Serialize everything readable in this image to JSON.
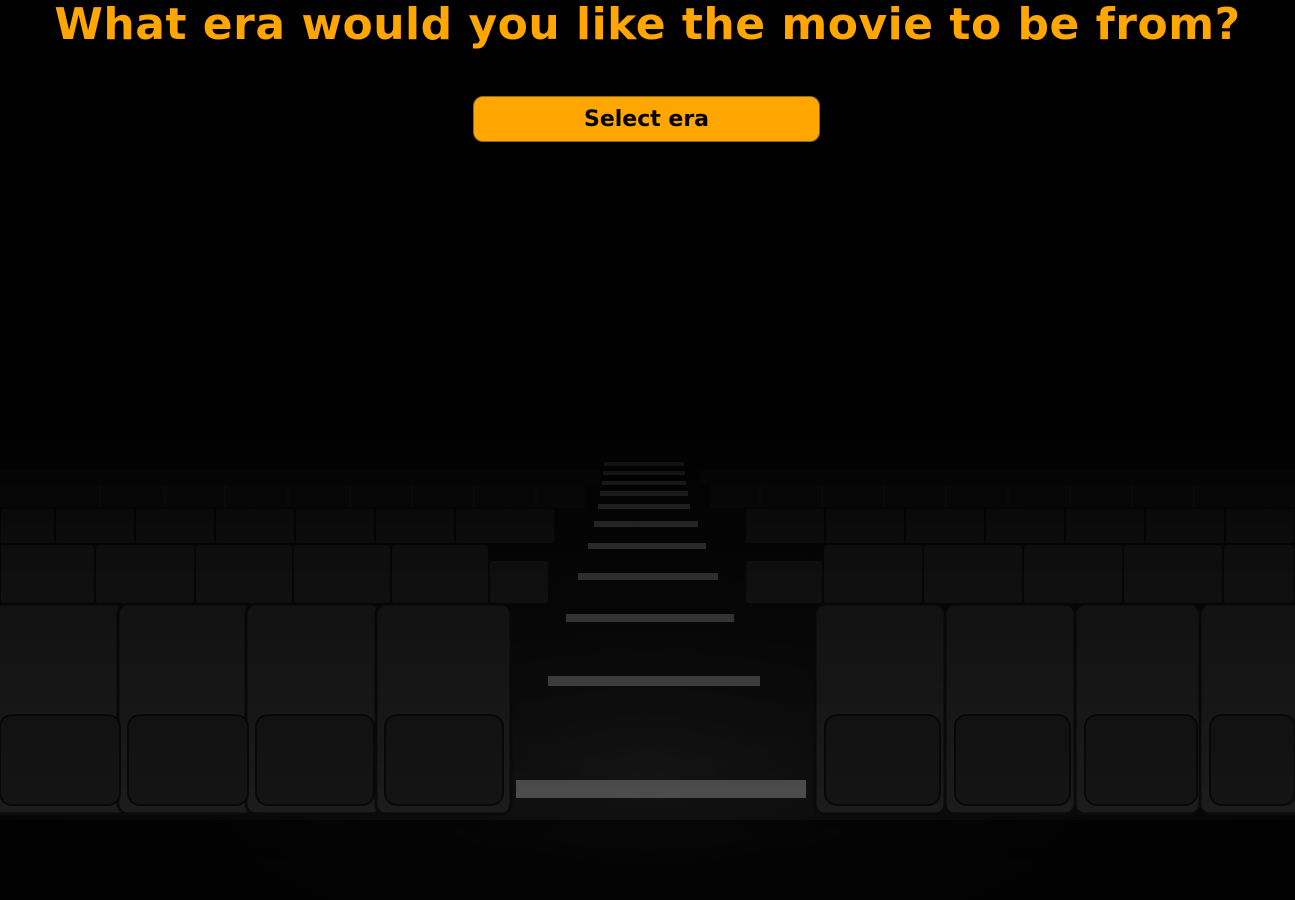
{
  "question": {
    "title": "What era would you like the movie to be from?"
  },
  "era_select": {
    "label": "Select era"
  },
  "background": {
    "icon": "cinema-seats-image"
  },
  "colors": {
    "accent": "#ffa600",
    "background": "#000000",
    "button_text": "#000000"
  }
}
